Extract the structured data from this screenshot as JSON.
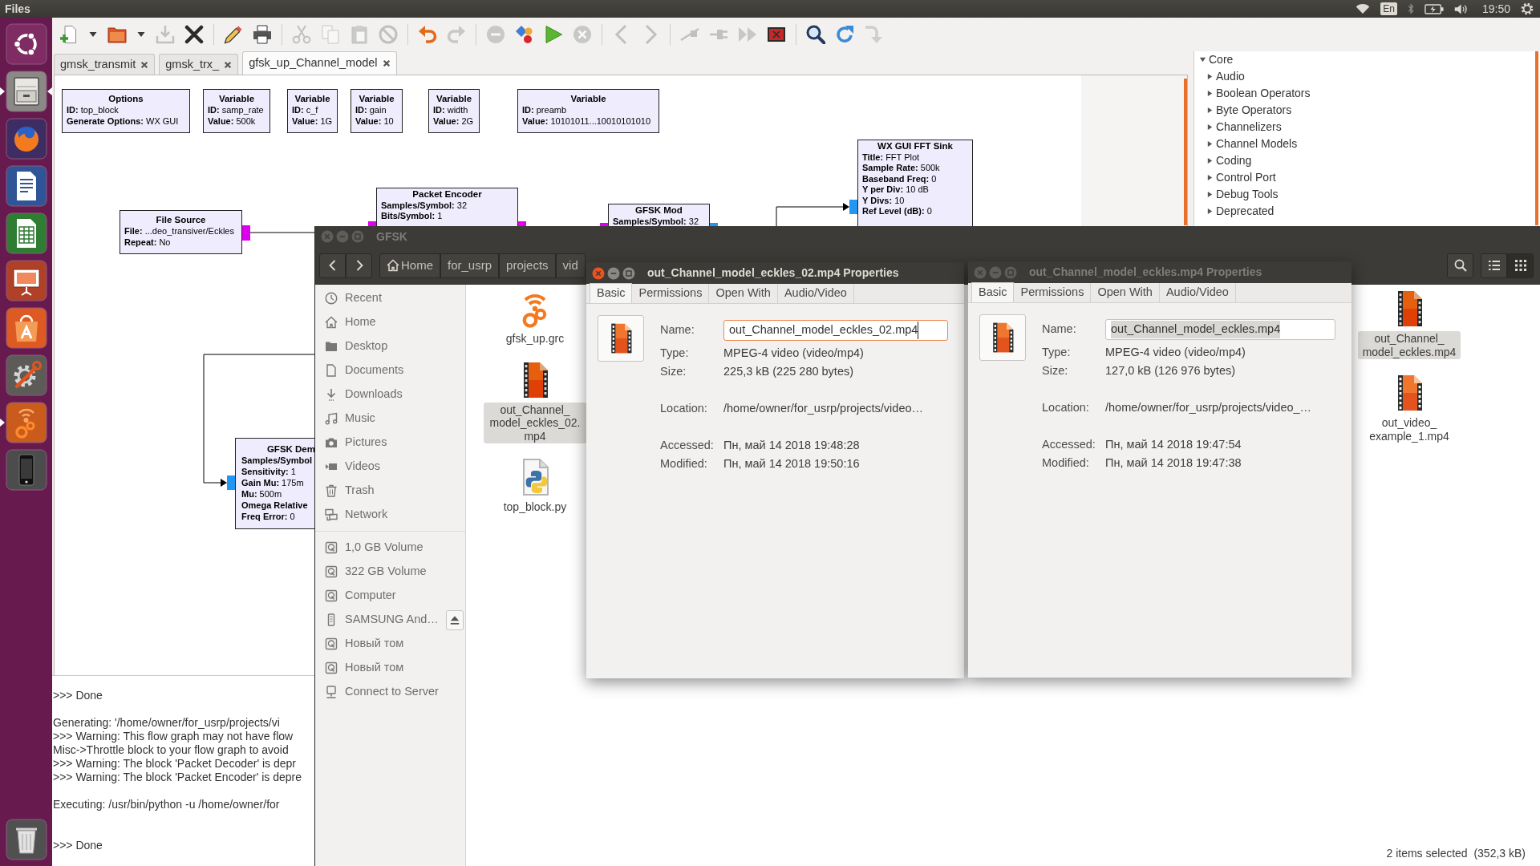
{
  "top_bar": {
    "app_name": "Files",
    "keyboard_layout": "En",
    "time": "19:50"
  },
  "launcher": [
    {
      "kind": "home",
      "running": false,
      "focused": false
    },
    {
      "kind": "files",
      "running": true,
      "focused": true
    },
    {
      "kind": "browser",
      "running": false,
      "focused": false
    },
    {
      "kind": "writer",
      "running": false,
      "focused": false
    },
    {
      "kind": "calc",
      "running": false,
      "focused": false
    },
    {
      "kind": "impress",
      "running": false,
      "focused": false
    },
    {
      "kind": "software",
      "running": false,
      "focused": false
    },
    {
      "kind": "settings",
      "running": false,
      "focused": false
    },
    {
      "kind": "gnuradio",
      "running": true,
      "focused": false
    },
    {
      "kind": "phone",
      "running": false,
      "focused": false
    },
    {
      "kind": "trash",
      "running": false,
      "focused": false
    }
  ],
  "toolbar": [
    [
      {
        "kind": "new",
        "disabled": false
      },
      {
        "kind": "dropdown",
        "disabled": false
      },
      {
        "kind": "open",
        "disabled": false
      },
      {
        "kind": "dropdown",
        "disabled": false
      },
      {
        "kind": "save",
        "disabled": true
      },
      {
        "kind": "close",
        "disabled": false
      }
    ],
    [
      {
        "kind": "edit",
        "disabled": false
      },
      {
        "kind": "print",
        "disabled": false
      }
    ],
    [
      {
        "kind": "cut",
        "disabled": true
      },
      {
        "kind": "copy",
        "disabled": true
      },
      {
        "kind": "paste",
        "disabled": true
      },
      {
        "kind": "disable",
        "disabled": true
      }
    ],
    [
      {
        "kind": "undo",
        "disabled": false
      },
      {
        "kind": "redo",
        "disabled": true
      }
    ],
    [
      {
        "kind": "remove",
        "disabled": true
      },
      {
        "kind": "blocks",
        "disabled": false
      },
      {
        "kind": "run",
        "disabled": false
      },
      {
        "kind": "stop",
        "disabled": true
      }
    ],
    [
      {
        "kind": "back",
        "disabled": true
      },
      {
        "kind": "forward",
        "disabled": true
      }
    ],
    [
      {
        "kind": "unplug",
        "disabled": true
      },
      {
        "kind": "plug",
        "disabled": true
      },
      {
        "kind": "skip",
        "disabled": true
      },
      {
        "kind": "screen",
        "disabled": false
      }
    ],
    [
      {
        "kind": "find",
        "disabled": false
      },
      {
        "kind": "reload",
        "disabled": false
      },
      {
        "kind": "descend",
        "disabled": true
      }
    ]
  ],
  "tabs": [
    {
      "label": "gmsk_transmit",
      "selected": false
    },
    {
      "label": "gmsk_trx_",
      "selected": false
    },
    {
      "label": "gfsk_up_Channel_model",
      "selected": true
    }
  ],
  "flow_graph": {
    "blocks": [
      {
        "title": "Options",
        "params": [
          {
            "name": "ID:",
            "value": "top_block"
          },
          {
            "name": "Generate Options:",
            "value": "WX GUI"
          }
        ]
      },
      {
        "title": "Variable",
        "params": [
          {
            "name": "ID:",
            "value": "samp_rate"
          },
          {
            "name": "Value:",
            "value": "500k"
          }
        ]
      },
      {
        "title": "Variable",
        "params": [
          {
            "name": "ID:",
            "value": "c_f"
          },
          {
            "name": "Value:",
            "value": "1G"
          }
        ]
      },
      {
        "title": "Variable",
        "params": [
          {
            "name": "ID:",
            "value": "gain"
          },
          {
            "name": "Value:",
            "value": "10"
          }
        ]
      },
      {
        "title": "Variable",
        "params": [
          {
            "name": "ID:",
            "value": "width"
          },
          {
            "name": "Value:",
            "value": "2G"
          }
        ]
      },
      {
        "title": "Variable",
        "params": [
          {
            "name": "ID:",
            "value": "preamb"
          },
          {
            "name": "Value:",
            "value": "10101011...10010101010"
          }
        ]
      },
      {
        "title": "File Source",
        "params": [
          {
            "name": "File:",
            "value": "...deo_transiver/Eckles"
          },
          {
            "name": "Repeat:",
            "value": "No"
          }
        ],
        "ports": [
          {
            "color": "#dd00ee"
          }
        ]
      },
      {
        "title": "Packet Encoder",
        "params": [
          {
            "name": "Samples/Symbol:",
            "value": "32"
          },
          {
            "name": "Bits/Symbol:",
            "value": "1"
          }
        ],
        "ports": [
          {
            "color": "#dd00ee"
          },
          {
            "color": "#dd00ee"
          }
        ]
      },
      {
        "title": "GFSK Mod",
        "params": [
          {
            "name": "Samples/Symbol:",
            "value": "32"
          }
        ],
        "ports": [
          {
            "color": "#dd00ee"
          },
          {
            "color": "#2196f3"
          }
        ]
      },
      {
        "title": "WX GUI FFT Sink",
        "params": [
          {
            "name": "Title:",
            "value": "FFT Plot"
          },
          {
            "name": "Sample Rate:",
            "value": "500k"
          },
          {
            "name": "Baseband Freq:",
            "value": "0"
          },
          {
            "name": "Y per Div:",
            "value": "10 dB"
          },
          {
            "name": "Y Divs:",
            "value": "10"
          },
          {
            "name": "Ref Level (dB):",
            "value": "0"
          }
        ],
        "ports": [
          {
            "color": "#2196f3"
          }
        ]
      },
      {
        "title": "GFSK Dem",
        "params": [
          {
            "name": "Samples/Symbol"
          },
          {
            "name": "Sensitivity:",
            "value": "1"
          },
          {
            "name": "Gain Mu:",
            "value": "175m"
          },
          {
            "name": "Mu:",
            "value": "500m"
          },
          {
            "name": "Omega Relative"
          },
          {
            "name": "Freq Error:",
            "value": "0"
          }
        ],
        "ports": [
          {
            "color": "#2196f3"
          }
        ]
      }
    ]
  },
  "console": [
    [
      ">>> Done"
    ],
    [
      "Generating: '/home/owner/for_usrp/projects/vi",
      ">>> Warning: This flow graph may not have flow",
      "Misc->Throttle block to your flow graph to avoid",
      ">>> Warning: The block 'Packet Decoder' is depr",
      ">>> Warning: The block 'Packet Encoder' is depre"
    ],
    [
      "Executing: /usr/bin/python -u /home/owner/for"
    ],
    [
      ">>> Done"
    ]
  ],
  "tree": [
    {
      "label": "Core",
      "expanded": true,
      "children": [
        {
          "label": "Audio",
          "expanded": false
        },
        {
          "label": "Boolean Operators",
          "expanded": false
        },
        {
          "label": "Byte Operators",
          "expanded": false
        },
        {
          "label": "Channelizers",
          "expanded": false
        },
        {
          "label": "Channel Models",
          "expanded": false
        },
        {
          "label": "Coding",
          "expanded": false
        },
        {
          "label": "Control Port",
          "expanded": false
        },
        {
          "label": "Debug Tools",
          "expanded": false
        },
        {
          "label": "Deprecated",
          "expanded": false
        }
      ]
    }
  ],
  "file_manager": {
    "title": "GFSK",
    "active": false,
    "path": [
      {
        "kind": "home",
        "label": "Home"
      },
      {
        "kind": "folder",
        "label": "for_usrp"
      },
      {
        "kind": "folder",
        "label": "projects"
      },
      {
        "kind": "folder",
        "label": "vid"
      }
    ],
    "views": [
      {
        "kind": "list",
        "selected": false
      },
      {
        "kind": "grid",
        "selected": true
      }
    ],
    "places": [
      {
        "kind": "recent",
        "label": "Recent"
      },
      {
        "kind": "home",
        "label": "Home"
      },
      {
        "kind": "desktop",
        "label": "Desktop"
      },
      {
        "kind": "documents",
        "label": "Documents"
      },
      {
        "kind": "downloads",
        "label": "Downloads"
      },
      {
        "kind": "music",
        "label": "Music"
      },
      {
        "kind": "pictures",
        "label": "Pictures"
      },
      {
        "kind": "videos",
        "label": "Videos"
      },
      {
        "kind": "trash",
        "label": "Trash"
      },
      {
        "kind": "network",
        "label": "Network"
      }
    ],
    "devices": [
      {
        "kind": "drive",
        "label": "1,0 GB Volume"
      },
      {
        "kind": "drive",
        "label": "322 GB Volume"
      },
      {
        "kind": "drive",
        "label": "Computer"
      },
      {
        "kind": "phone",
        "label": "SAMSUNG And…"
      },
      {
        "kind": "drive",
        "label": "Новый том"
      },
      {
        "kind": "drive",
        "label": "Новый том"
      },
      {
        "kind": "server",
        "label": "Connect to Server"
      }
    ],
    "files": [
      [
        {
          "kind": "grc",
          "name": "gfsk_up.grc",
          "selected": false
        },
        {
          "kind": "video",
          "name": "out_Channel_model_eckles_02.mp4",
          "selected": true
        },
        {
          "kind": "python",
          "name": "top_block.py",
          "selected": false
        }
      ],
      [
        {
          "kind": "video",
          "name": "out_Channel_model_eckles.mp4",
          "selected": true
        },
        {
          "kind": "video",
          "name": "out_video_example_1.mp4",
          "selected": false
        }
      ]
    ],
    "status": "2 items selected  (352,3 kB)"
  },
  "dialogs": [
    {
      "title": "out_Channel_model_eckles_02.mp4 Properties",
      "active": true,
      "tabs": [
        {
          "label": "Basic",
          "selected": true
        },
        {
          "label": "Permissions",
          "selected": false
        },
        {
          "label": "Open With",
          "selected": false
        },
        {
          "label": "Audio/Video",
          "selected": false
        }
      ],
      "name": {
        "label": "Name:",
        "value": "out_Channel_model_eckles_02.mp4",
        "focused": true,
        "text_selected": false
      },
      "details": [
        [
          {
            "label": "Type:",
            "value": "MPEG-4 video (video/mp4)"
          },
          {
            "label": "Size:",
            "value": "225,3 kB (225 280 bytes)"
          }
        ],
        [
          {
            "label": "Location:",
            "value": "/home/owner/for_usrp/projects/video…"
          }
        ],
        [
          {
            "label": "Accessed:",
            "value": "Пн, май 14 2018 19:48:28"
          },
          {
            "label": "Modified:",
            "value": "Пн, май 14 2018 19:50:16"
          }
        ]
      ]
    },
    {
      "title": "out_Channel_model_eckles.mp4 Properties",
      "active": false,
      "tabs": [
        {
          "label": "Basic",
          "selected": true
        },
        {
          "label": "Permissions",
          "selected": false
        },
        {
          "label": "Open With",
          "selected": false
        },
        {
          "label": "Audio/Video",
          "selected": false
        }
      ],
      "name": {
        "label": "Name:",
        "value": "out_Channel_model_eckles.mp4",
        "focused": false,
        "text_selected": true
      },
      "details": [
        [
          {
            "label": "Type:",
            "value": "MPEG-4 video (video/mp4)"
          },
          {
            "label": "Size:",
            "value": "127,0 kB (126 976 bytes)"
          }
        ],
        [
          {
            "label": "Location:",
            "value": "/home/owner/for_usrp/projects/video_…"
          }
        ],
        [
          {
            "label": "Accessed:",
            "value": "Пн, май 14 2018 19:47:54"
          },
          {
            "label": "Modified:",
            "value": "Пн, май 14 2018 19:47:38"
          }
        ]
      ]
    }
  ]
}
